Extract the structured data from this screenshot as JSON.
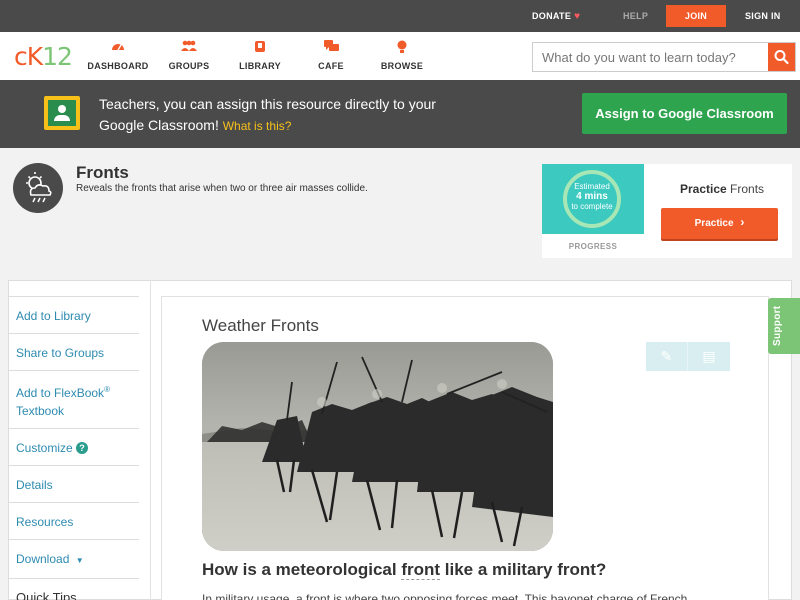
{
  "topbar": {
    "donate": "DONATE",
    "help": "HELP",
    "join": "JOIN",
    "signin": "SIGN IN"
  },
  "logo": {
    "left": "cK",
    "right": "12"
  },
  "nav": [
    {
      "label": "DASHBOARD",
      "icon": "dashboard-icon"
    },
    {
      "label": "GROUPS",
      "icon": "groups-icon"
    },
    {
      "label": "LIBRARY",
      "icon": "library-icon"
    },
    {
      "label": "CAFE",
      "icon": "cafe-icon"
    },
    {
      "label": "BROWSE",
      "icon": "browse-icon"
    }
  ],
  "search": {
    "placeholder": "What do you want to learn today?"
  },
  "banner": {
    "text": "Teachers, you can assign this resource directly to your Google Classroom!",
    "link": "What is this?",
    "button": "Assign to Google Classroom"
  },
  "concept": {
    "title": "Fronts",
    "description": "Reveals the fronts that arise when two or three air masses collide."
  },
  "practice": {
    "estimated": "Estimated",
    "minutes": "4 mins",
    "to_complete": "to complete",
    "progress_label": "PROGRESS",
    "title_bold": "Practice",
    "title_rest": "Fronts",
    "button": "Practice"
  },
  "sidebar": [
    {
      "label": "Add to Library"
    },
    {
      "label": "Share to Groups"
    },
    {
      "label": "Add to FlexBook",
      "reg": "®",
      "line2": "Textbook"
    },
    {
      "label": "Customize"
    },
    {
      "label": "Details"
    },
    {
      "label": "Resources"
    },
    {
      "label": "Download"
    },
    {
      "label": "Quick Tips"
    }
  ],
  "article": {
    "title": "Weather Fronts",
    "question_pre": "How is a meteorological ",
    "question_kw": "front",
    "question_post": " like a military front?",
    "paragraph": "In military usage, a front is where two opposing forces meet. This bayonet charge of French"
  },
  "support": "Support",
  "colors": {
    "accent": "#f15a29",
    "google_green": "#2ea44f",
    "link_blue": "#2e8bb0",
    "dark_bar": "#4a4a4a",
    "support_green": "#7cc576"
  }
}
